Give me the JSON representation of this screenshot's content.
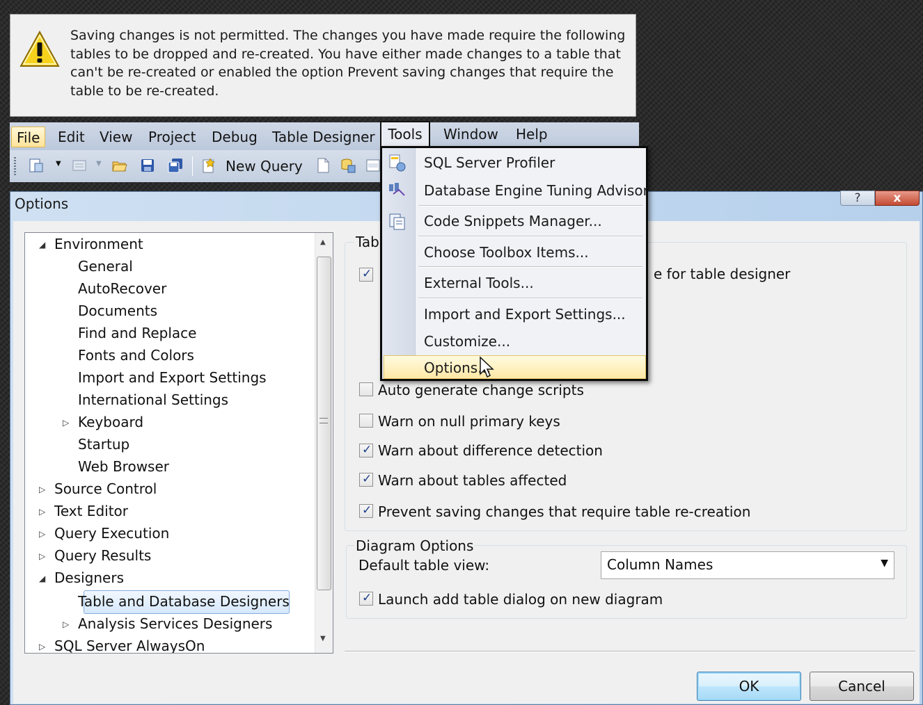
{
  "warning": {
    "icon": "warning-icon",
    "message": "Saving changes is not permitted. The changes you have made require the following tables to be dropped and re-created. You have either made changes to a table that can't be re-created or enabled the option Prevent saving changes that require the table to be re-created."
  },
  "menubar": {
    "items": [
      "File",
      "Edit",
      "View",
      "Project",
      "Debug",
      "Table Designer",
      "Tools",
      "Window",
      "Help"
    ]
  },
  "toolbar": {
    "new_query_label": "New Query"
  },
  "tools_menu": {
    "items": [
      {
        "label": "SQL Server Profiler",
        "icon": "profiler-icon"
      },
      {
        "label": "Database Engine Tuning Advisor",
        "icon": "tuning-advisor-icon"
      },
      {
        "label": "Code Snippets Manager...",
        "icon": "code-snippets-icon"
      },
      {
        "label": "Choose Toolbox Items...",
        "icon": ""
      },
      {
        "label": "External Tools...",
        "icon": ""
      },
      {
        "label": "Import and Export Settings...",
        "icon": ""
      },
      {
        "label": "Customize...",
        "icon": ""
      },
      {
        "label": "Options...",
        "icon": ""
      }
    ],
    "highlighted": "Options..."
  },
  "options_dialog": {
    "title": "Options",
    "help_glyph": "?",
    "close_glyph": "x",
    "tree": [
      {
        "label": "Environment",
        "expanded": true
      },
      {
        "label": "General"
      },
      {
        "label": "AutoRecover"
      },
      {
        "label": "Documents"
      },
      {
        "label": "Find and Replace"
      },
      {
        "label": "Fonts and Colors"
      },
      {
        "label": "Import and Export Settings"
      },
      {
        "label": "International Settings"
      },
      {
        "label": "Keyboard",
        "expanded": false
      },
      {
        "label": "Startup"
      },
      {
        "label": "Web Browser"
      },
      {
        "label": "Source Control",
        "expanded": false
      },
      {
        "label": "Text Editor",
        "expanded": false
      },
      {
        "label": "Query Execution",
        "expanded": false
      },
      {
        "label": "Query Results",
        "expanded": false
      },
      {
        "label": "Designers",
        "expanded": true
      },
      {
        "label": "Table and Database Designers",
        "selected": true
      },
      {
        "label": "Analysis Services Designers",
        "expanded": false
      },
      {
        "label": "SQL Server AlwaysOn",
        "expanded": false
      }
    ],
    "table_options": {
      "group_title_visible": "Tab",
      "partial_label_visible": "e for table designer",
      "first_checkbox_checked": true,
      "checkboxes": [
        {
          "label": "Auto generate change scripts",
          "checked": false
        },
        {
          "label": "Warn on null primary keys",
          "checked": false
        },
        {
          "label": "Warn about difference detection",
          "checked": true
        },
        {
          "label": "Warn about tables affected",
          "checked": true
        },
        {
          "label": "Prevent saving changes that require table re-creation",
          "checked": true
        }
      ]
    },
    "diagram_options": {
      "group_title": "Diagram Options",
      "default_view_label": "Default table view:",
      "default_view_value": "Column Names",
      "launch_checkbox": {
        "label": "Launch add table dialog on new diagram",
        "checked": true
      }
    },
    "buttons": {
      "ok": "OK",
      "cancel": "Cancel"
    }
  },
  "colors": {
    "menu_highlight": "#ffe8a6",
    "selection_border": "#84acdd",
    "dialog_frame": "#b6d0ec"
  }
}
